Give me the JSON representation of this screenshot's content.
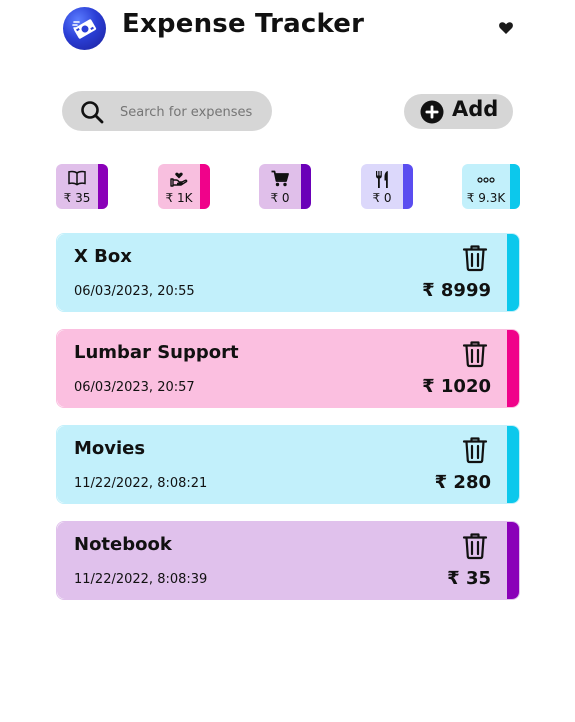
{
  "app": {
    "title": "Expense Tracker"
  },
  "search": {
    "placeholder": "Search for expenses",
    "value": ""
  },
  "add_button": {
    "label": "Add"
  },
  "categories": [
    {
      "icon": "book-icon",
      "value": "₹ 35",
      "bg": "#e0bfea",
      "accent": "#8a00b8"
    },
    {
      "icon": "hands-heart-icon",
      "value": "₹ 1K",
      "bg": "#f8bfdf",
      "accent": "#f0028a"
    },
    {
      "icon": "cart-icon",
      "value": "₹ 0",
      "bg": "#e0bfea",
      "accent": "#6a00b8"
    },
    {
      "icon": "fork-knife-icon",
      "value": "₹ 0",
      "bg": "#dcd8fb",
      "accent": "#5a4df0"
    },
    {
      "icon": "more-dots-icon",
      "value": "₹ 9.3K",
      "bg": "#c2f0fb",
      "accent": "#0cc8ec"
    }
  ],
  "expenses": [
    {
      "name": "X Box",
      "date": "06/03/2023, 20:55",
      "amount": "₹ 8999",
      "bg": "#c2f0fb",
      "accent": "#0cc8ec"
    },
    {
      "name": "Lumbar Support",
      "date": "06/03/2023, 20:57",
      "amount": "₹ 1020",
      "bg": "#fbbfe0",
      "accent": "#f0028a"
    },
    {
      "name": "Movies",
      "date": "11/22/2022, 8:08:21",
      "amount": "₹ 280",
      "bg": "#c2f0fb",
      "accent": "#0cc8ec"
    },
    {
      "name": "Notebook",
      "date": "11/22/2022, 8:08:39",
      "amount": "₹ 35",
      "bg": "#e0c1ec",
      "accent": "#8a00b8"
    }
  ]
}
